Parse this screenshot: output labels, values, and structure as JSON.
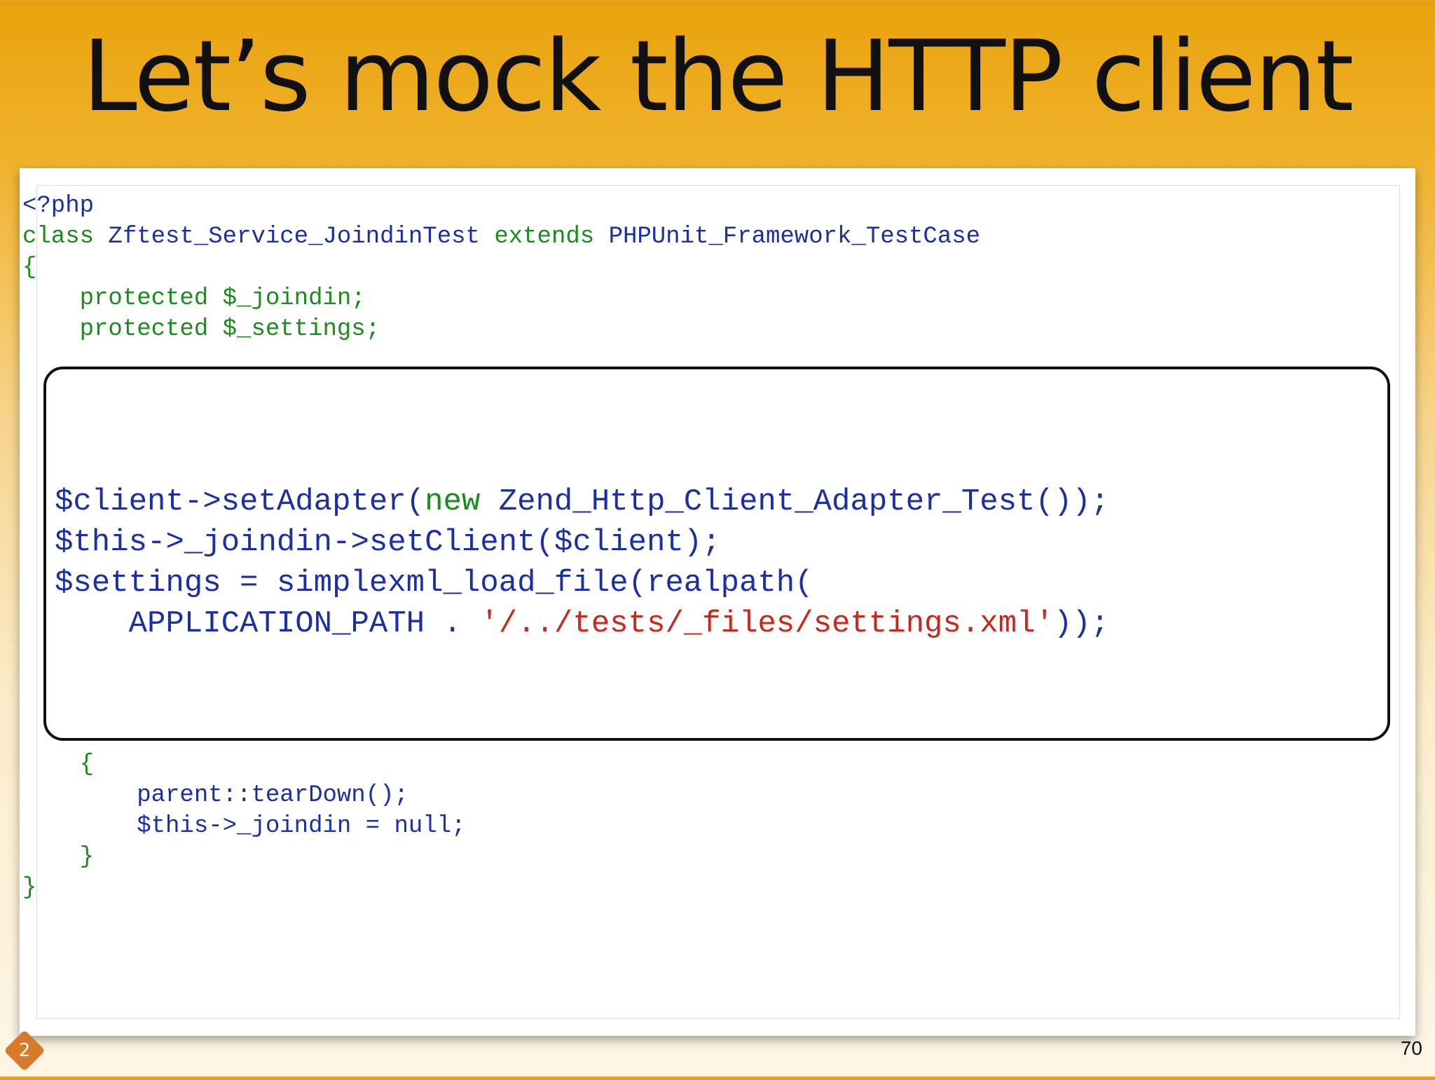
{
  "slide": {
    "title": "Let’s mock the HTTP client",
    "page_number": "70",
    "logo_text": "2"
  },
  "code_top": {
    "l1": "<?php",
    "l2_kw": "class ",
    "l2_cls": "Zftest_Service_JoindinTest",
    "l2_ext": " extends ",
    "l2_base": "PHPUnit_Framework_TestCase",
    "l3": "{",
    "l4_kw": "    protected ",
    "l4_var": "$_joindin;",
    "l5_kw": "    protected ",
    "l5_var": "$_settings;"
  },
  "callout": {
    "c1_a": "$client->setAdapter(",
    "c1_b": "new ",
    "c1_c": "Zend_Http_Client_Adapter_Test());",
    "c2": "$this->_joindin->setClient($client);",
    "c3_a": "$settings = simplexml_load_file(realpath(",
    "c4_a": "    APPLICATION_PATH . ",
    "c4_str": "'/../tests/_files/settings.xml'",
    "c4_end": "));"
  },
  "code_bottom": {
    "b1": "    {",
    "b2": "        parent::tearDown();",
    "b3": "        $this->_joindin = null;",
    "b4": "    }",
    "b5": "}"
  }
}
